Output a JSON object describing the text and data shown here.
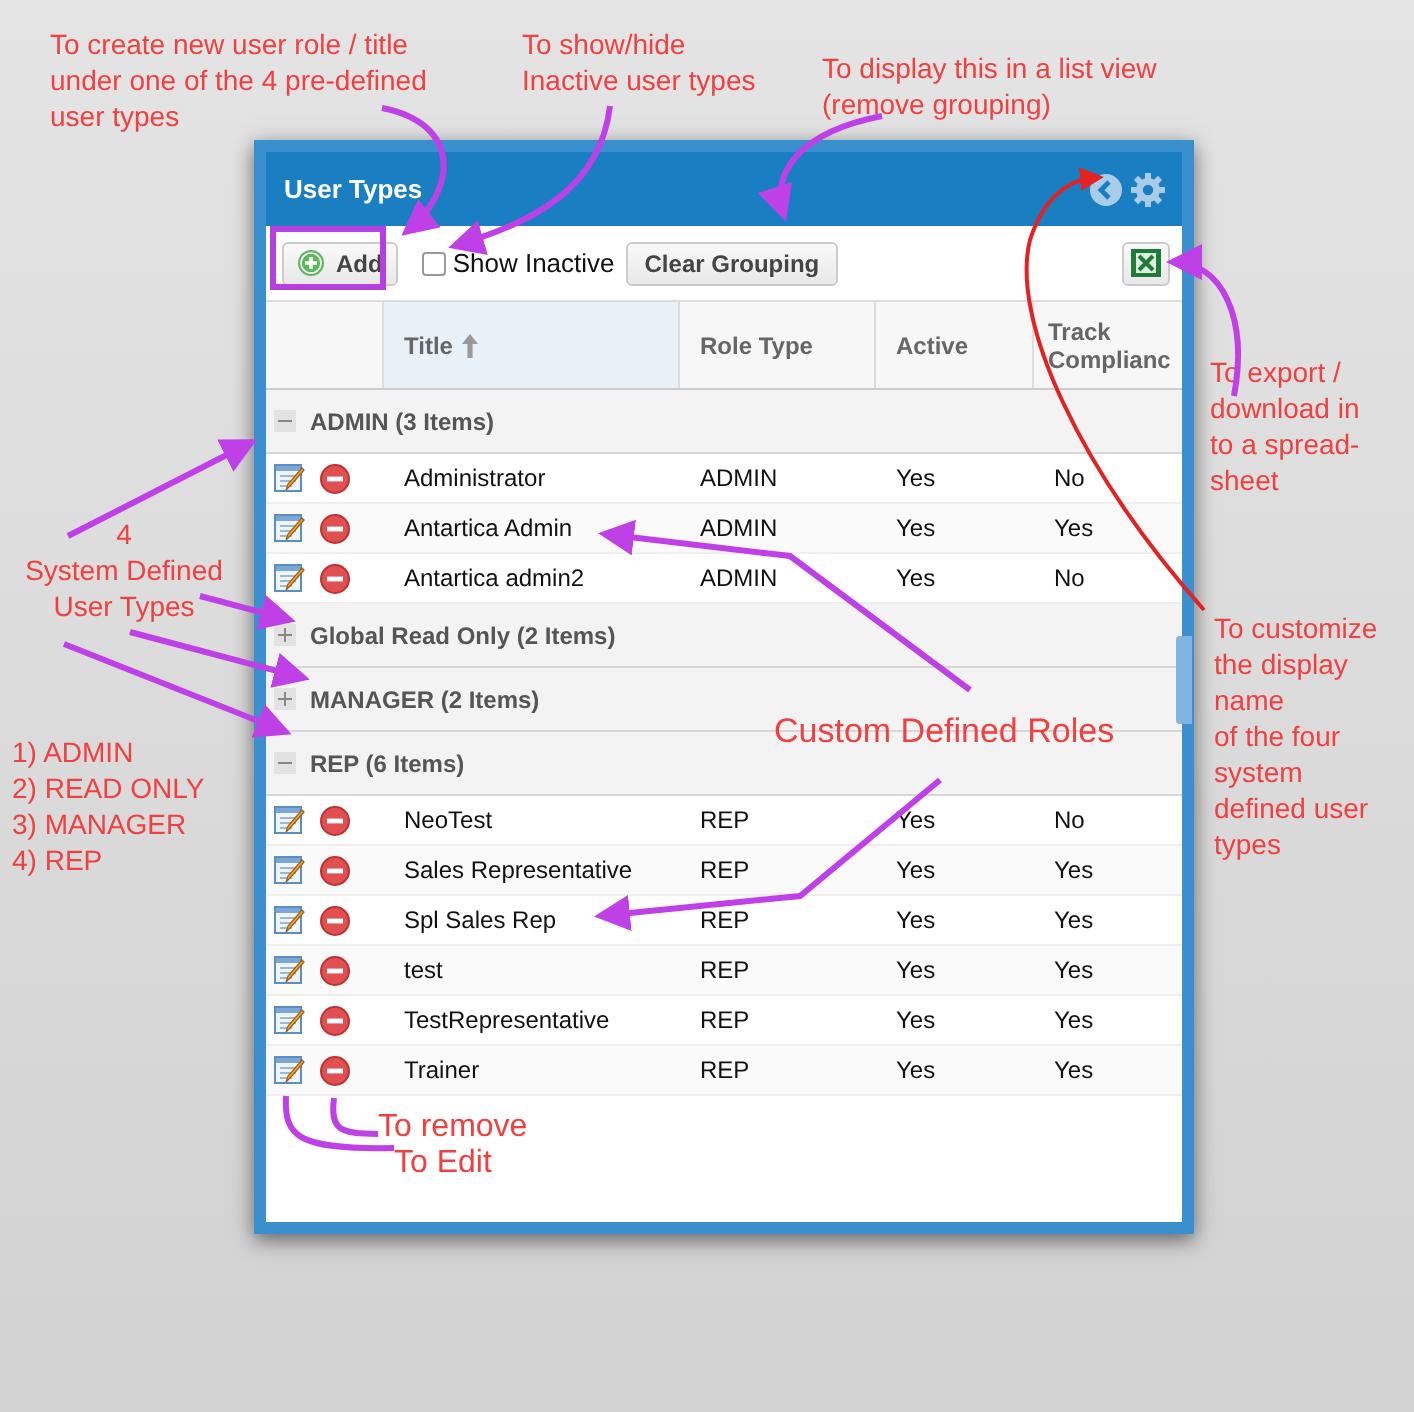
{
  "window": {
    "title": "User Types"
  },
  "toolbar": {
    "add_button": "Add",
    "show_inactive": {
      "label": "Show Inactive",
      "checked": false
    },
    "clear_grouping_button": "Clear Grouping"
  },
  "table": {
    "columns": [
      {
        "label": "Title",
        "sorted": true
      },
      {
        "label": "Role Type",
        "sorted": false
      },
      {
        "label": "Active",
        "sorted": false
      },
      {
        "label": "Track Complianc",
        "sorted": false
      }
    ],
    "groups": [
      {
        "label": "ADMIN (3 Items)",
        "expanded": true,
        "rows": [
          {
            "cells": [
              "Administrator",
              "ADMIN",
              "Yes",
              "No"
            ]
          },
          {
            "cells": [
              "Antartica Admin",
              "ADMIN",
              "Yes",
              "Yes"
            ]
          },
          {
            "cells": [
              "Antartica admin2",
              "ADMIN",
              "Yes",
              "No"
            ]
          }
        ]
      },
      {
        "label": "Global Read Only (2 Items)",
        "expanded": false
      },
      {
        "label": "MANAGER (2 Items)",
        "expanded": false
      },
      {
        "label": "REP (6 Items)",
        "expanded": true,
        "rows": [
          {
            "cells": [
              "NeoTest",
              "REP",
              "Yes",
              "No"
            ]
          },
          {
            "cells": [
              "Sales Representative",
              "REP",
              "Yes",
              "Yes"
            ]
          },
          {
            "cells": [
              "Spl Sales Rep",
              "REP",
              "Yes",
              "Yes"
            ]
          },
          {
            "cells": [
              "test",
              "REP",
              "Yes",
              "Yes"
            ]
          },
          {
            "cells": [
              "TestRepresentative",
              "REP",
              "Yes",
              "Yes"
            ]
          },
          {
            "cells": [
              "Trainer",
              "REP",
              "Yes",
              "Yes"
            ]
          }
        ]
      }
    ]
  },
  "annotations": [
    {
      "lines": [
        "To create new user role / title",
        "under one of the 4 pre-defined",
        "user types"
      ]
    },
    {
      "lines": [
        "To show/hide",
        "Inactive user types"
      ]
    },
    {
      "lines": [
        "To display this in a list view",
        "(remove grouping)"
      ]
    },
    {
      "lines": [
        "To export /",
        "download in",
        "to a spread-",
        "sheet"
      ]
    },
    {
      "lines": [
        "To customize",
        "the display",
        "name",
        "of the four",
        "system",
        "defined user",
        "types"
      ]
    },
    {
      "lines": [
        "4",
        "System Defined",
        "User Types"
      ]
    },
    {
      "lines": [
        "1) ADMIN",
        "2) READ ONLY",
        "3) MANAGER",
        "4) REP"
      ]
    },
    {
      "lines": [
        "Custom Defined Roles"
      ]
    },
    {
      "lines": [
        "To remove"
      ]
    },
    {
      "lines": [
        "To Edit"
      ]
    }
  ]
}
